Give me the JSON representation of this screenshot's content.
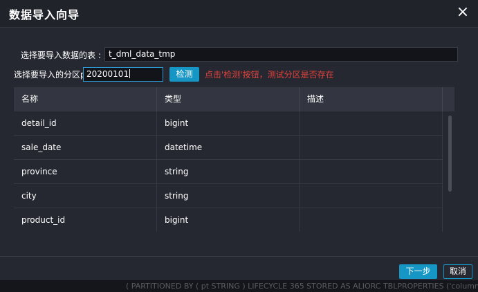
{
  "dialog": {
    "title": "数据导入向导",
    "close_icon": "×"
  },
  "form": {
    "table_label": "选择要导入数据的表 :",
    "table_value": "t_dml_data_tmp",
    "partition_label": "选择要导入的分区pt =",
    "partition_value": "20200101",
    "check_button": "检测",
    "hint": "点击'检测'按钮，测试分区是否存在"
  },
  "grid": {
    "columns": [
      "名称",
      "类型",
      "描述"
    ],
    "rows": [
      {
        "name": "detail_id",
        "type": "bigint",
        "desc": ""
      },
      {
        "name": "sale_date",
        "type": "datetime",
        "desc": ""
      },
      {
        "name": "province",
        "type": "string",
        "desc": ""
      },
      {
        "name": "city",
        "type": "string",
        "desc": ""
      },
      {
        "name": "product_id",
        "type": "bigint",
        "desc": ""
      }
    ]
  },
  "footer": {
    "next_button": "下一步",
    "cancel_button": "取消"
  },
  "background": {
    "snippet": "( PARTITIONED BY ( pt STRING ) LIFECYCLE 365 STORED AS ALIORC TBLPROPERTIES ('columnar.nested.type'='true')"
  },
  "colors": {
    "accent": "#1596c4",
    "hint": "#e2423c",
    "dialog_bg": "#262831",
    "header_bg": "#333640"
  }
}
